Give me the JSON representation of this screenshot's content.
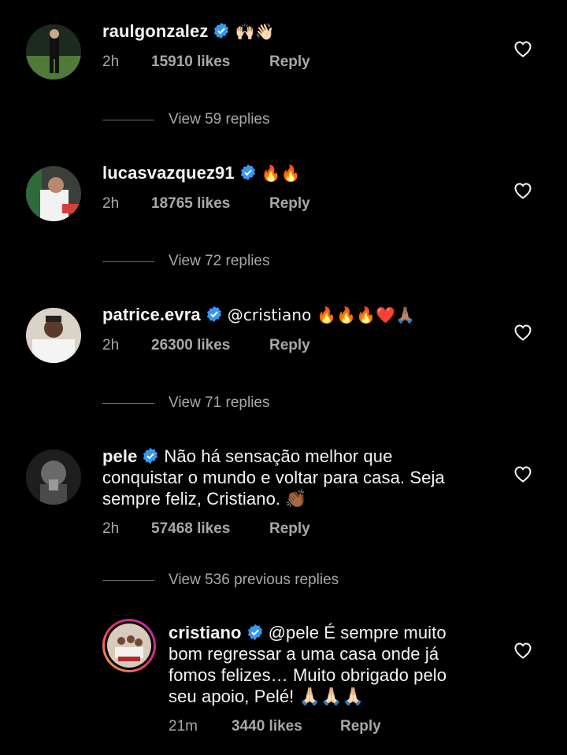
{
  "comments": [
    {
      "username": "raulgonzalez",
      "text": "🙌🏻👋🏻",
      "time": "2h",
      "likes": "15910 likes",
      "reply": "Reply",
      "view_replies": "View 59 replies"
    },
    {
      "username": "lucasvazquez91",
      "text": "🔥🔥",
      "time": "2h",
      "likes": "18765 likes",
      "reply": "Reply",
      "view_replies": "View 72 replies"
    },
    {
      "username": "patrice.evra",
      "text": "@cristiano 🔥🔥🔥❤️🙏🏽",
      "time": "2h",
      "likes": "26300 likes",
      "reply": "Reply",
      "view_replies": "View 71 replies"
    },
    {
      "username": "pele",
      "text_lines": [
        "Não há sensação melhor que",
        "conquistar o mundo e voltar para casa. Seja",
        "sempre feliz, Cristiano. 👏🏾"
      ],
      "time": "2h",
      "likes": "57468 likes",
      "reply": "Reply",
      "view_replies": "View 536 previous replies"
    },
    {
      "username": "cristiano",
      "text_lines": [
        "@pele É sempre muito",
        "bom regressar a uma casa onde já",
        "fomos felizes… Muito obrigado pelo",
        "seu apoio, Pelé! 🙏🏻🙏🏻🙏🏻"
      ],
      "time": "21m",
      "likes": "3440 likes",
      "reply": "Reply"
    }
  ],
  "colors": {
    "background": "#000000",
    "text": "#f5f5f5",
    "muted": "#a8a8a8",
    "verified": "#3897f0"
  },
  "icons": {
    "verified": "verified-badge-icon",
    "like": "heart-outline-icon"
  }
}
